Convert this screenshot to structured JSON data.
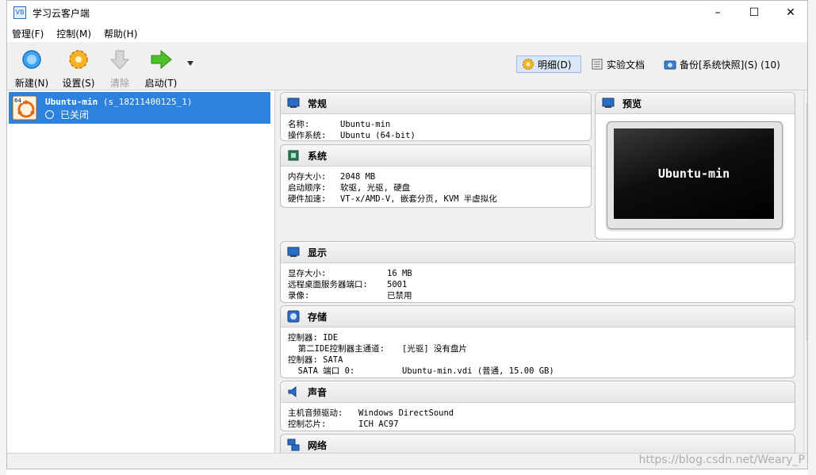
{
  "window": {
    "title": "学习云客户端",
    "minimize": "–",
    "maximize": "☐",
    "close": "✕",
    "icon_text": "VB"
  },
  "menubar": [
    "管理(F)",
    "控制(M)",
    "帮助(H)"
  ],
  "toolbar": {
    "new": "新建(N)",
    "settings": "设置(S)",
    "discard": "清除",
    "start": "启动(T)",
    "details": "明细(D)",
    "docs": "实验文档",
    "snapshots": "备份[系统快照](S) (10)"
  },
  "vm": {
    "name": "Ubuntu-min",
    "id": "(s_18211400125_1)",
    "state": "已关闭",
    "badge": "64"
  },
  "cards": {
    "general": {
      "title": "常规",
      "name_k": "名称:",
      "name_v": "Ubuntu-min",
      "os_k": "操作系统:",
      "os_v": "Ubuntu (64-bit)"
    },
    "system": {
      "title": "系统",
      "mem_k": "内存大小:",
      "mem_v": "2048 MB",
      "boot_k": "启动顺序:",
      "boot_v": "软驱, 光驱, 硬盘",
      "accel_k": "硬件加速:",
      "accel_v": "VT-x/AMD-V, 嵌套分页, KVM 半虚拟化"
    },
    "preview": {
      "title": "预览",
      "screen_text": "Ubuntu-min"
    },
    "display": {
      "title": "显示",
      "vram_k": "显存大小:",
      "vram_v": "16 MB",
      "rdp_k": "远程桌面服务器端口:",
      "rdp_v": "5001",
      "rec_k": "录像:",
      "rec_v": "已禁用"
    },
    "storage": {
      "title": "存储",
      "c1": "控制器: IDE",
      "c1d_k": "  第二IDE控制器主通道:",
      "c1d_v": "[光驱] 没有盘片",
      "c2": "控制器: SATA",
      "c2d_k": "  SATA 端口 0:",
      "c2d_v": "Ubuntu-min.vdi (普通, 15.00 GB)"
    },
    "audio": {
      "title": "声音",
      "drv_k": "主机音频驱动:",
      "drv_v": "Windows DirectSound",
      "chip_k": "控制芯片:",
      "chip_v": "ICH AC97"
    },
    "network": {
      "title": "网络"
    }
  },
  "watermark": "https://blog.csdn.net/Weary_P",
  "colors": {
    "selection": "#2d82e0"
  }
}
